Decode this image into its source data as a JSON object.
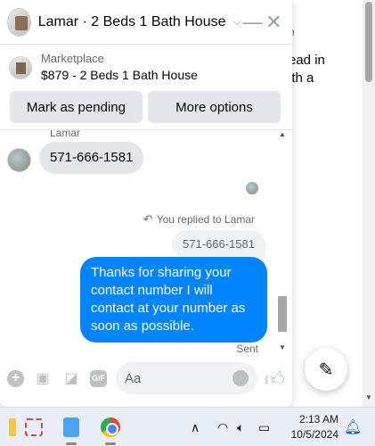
{
  "background": {
    "side_lines": [
      "n",
      "ead in",
      "ith a"
    ]
  },
  "chat": {
    "title": "Lamar · 2 Beds 1 Bath House",
    "marketplace_label": "Marketplace",
    "marketplace_item": "$879 - 2 Beds 1 Bath House",
    "actions": {
      "pending": "Mark as pending",
      "more": "More options"
    },
    "messages": {
      "sender": "Lamar",
      "incoming": "571-666-1581",
      "replied_note": "You replied to Lamar",
      "quoted": "571-666-1581",
      "outgoing": "Thanks for sharing your contact number I will contact at your number as soon as possible.",
      "status": "Sent"
    },
    "composer": {
      "placeholder": "Aa",
      "gif": "GIF"
    }
  },
  "taskbar": {
    "time": "2:13 AM",
    "date": "10/5/2024"
  },
  "colors": {
    "accent": "#0084ff",
    "bubble_in": "#e4e6eb"
  }
}
